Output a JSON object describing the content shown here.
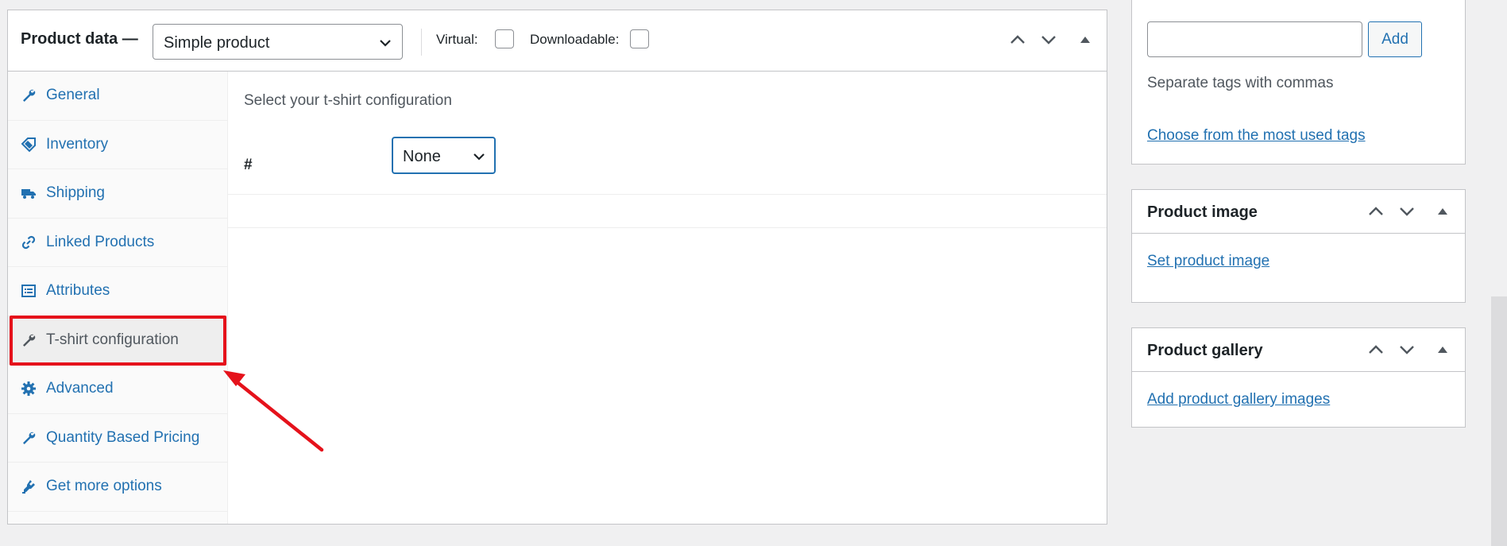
{
  "product_data": {
    "title": "Product data —",
    "type_select": "Simple product",
    "virtual_label": "Virtual:",
    "downloadable_label": "Downloadable:",
    "tabs": [
      {
        "label": "General",
        "icon": "wrench-icon"
      },
      {
        "label": "Inventory",
        "icon": "tag-icon"
      },
      {
        "label": "Shipping",
        "icon": "truck-icon"
      },
      {
        "label": "Linked Products",
        "icon": "link-icon"
      },
      {
        "label": "Attributes",
        "icon": "list-icon"
      },
      {
        "label": "T-shirt configuration",
        "icon": "wrench-icon",
        "active": true
      },
      {
        "label": "Advanced",
        "icon": "gear-icon"
      },
      {
        "label": "Quantity Based Pricing",
        "icon": "wrench-icon"
      },
      {
        "label": "Get more options",
        "icon": "plugin-icon"
      }
    ],
    "content": {
      "description": "Select your t-shirt configuration",
      "row_label": "#",
      "select_value": "None"
    }
  },
  "tags": {
    "add_label": "Add",
    "hint": "Separate tags with commas",
    "most_used_link": "Choose from the most used tags"
  },
  "product_image": {
    "title": "Product image",
    "link": "Set product image"
  },
  "product_gallery": {
    "title": "Product gallery",
    "link": "Add product gallery images"
  },
  "colors": {
    "link": "#2271b1",
    "highlight": "#e5121b"
  }
}
